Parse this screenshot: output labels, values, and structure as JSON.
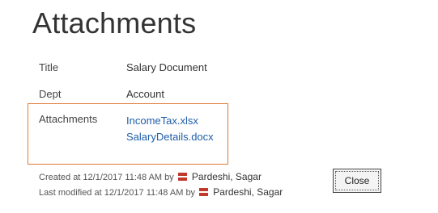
{
  "dialog": {
    "title": "Attachments"
  },
  "fields": [
    {
      "label": "Title",
      "value": "Salary Document"
    },
    {
      "label": "Dept",
      "value": "Account"
    }
  ],
  "attachments": {
    "label": "Attachments",
    "files": [
      "IncomeTax.xlsx",
      "SalaryDetails.docx"
    ],
    "highlight_color": "#e07b39"
  },
  "metadata": {
    "created_prefix": "Created at 12/1/2017 11:48 AM",
    "created_by_word": "by",
    "created_user": "Pardeshi, Sagar",
    "modified_prefix": "Last modified at 12/1/2017 11:48 AM",
    "modified_by_word": "by",
    "modified_user": "Pardeshi, Sagar",
    "presence_icon": "user-presence-icon",
    "presence_color": "#c0392b"
  },
  "buttons": {
    "close_label": "Close"
  },
  "colors": {
    "link": "#1f5ea8"
  }
}
